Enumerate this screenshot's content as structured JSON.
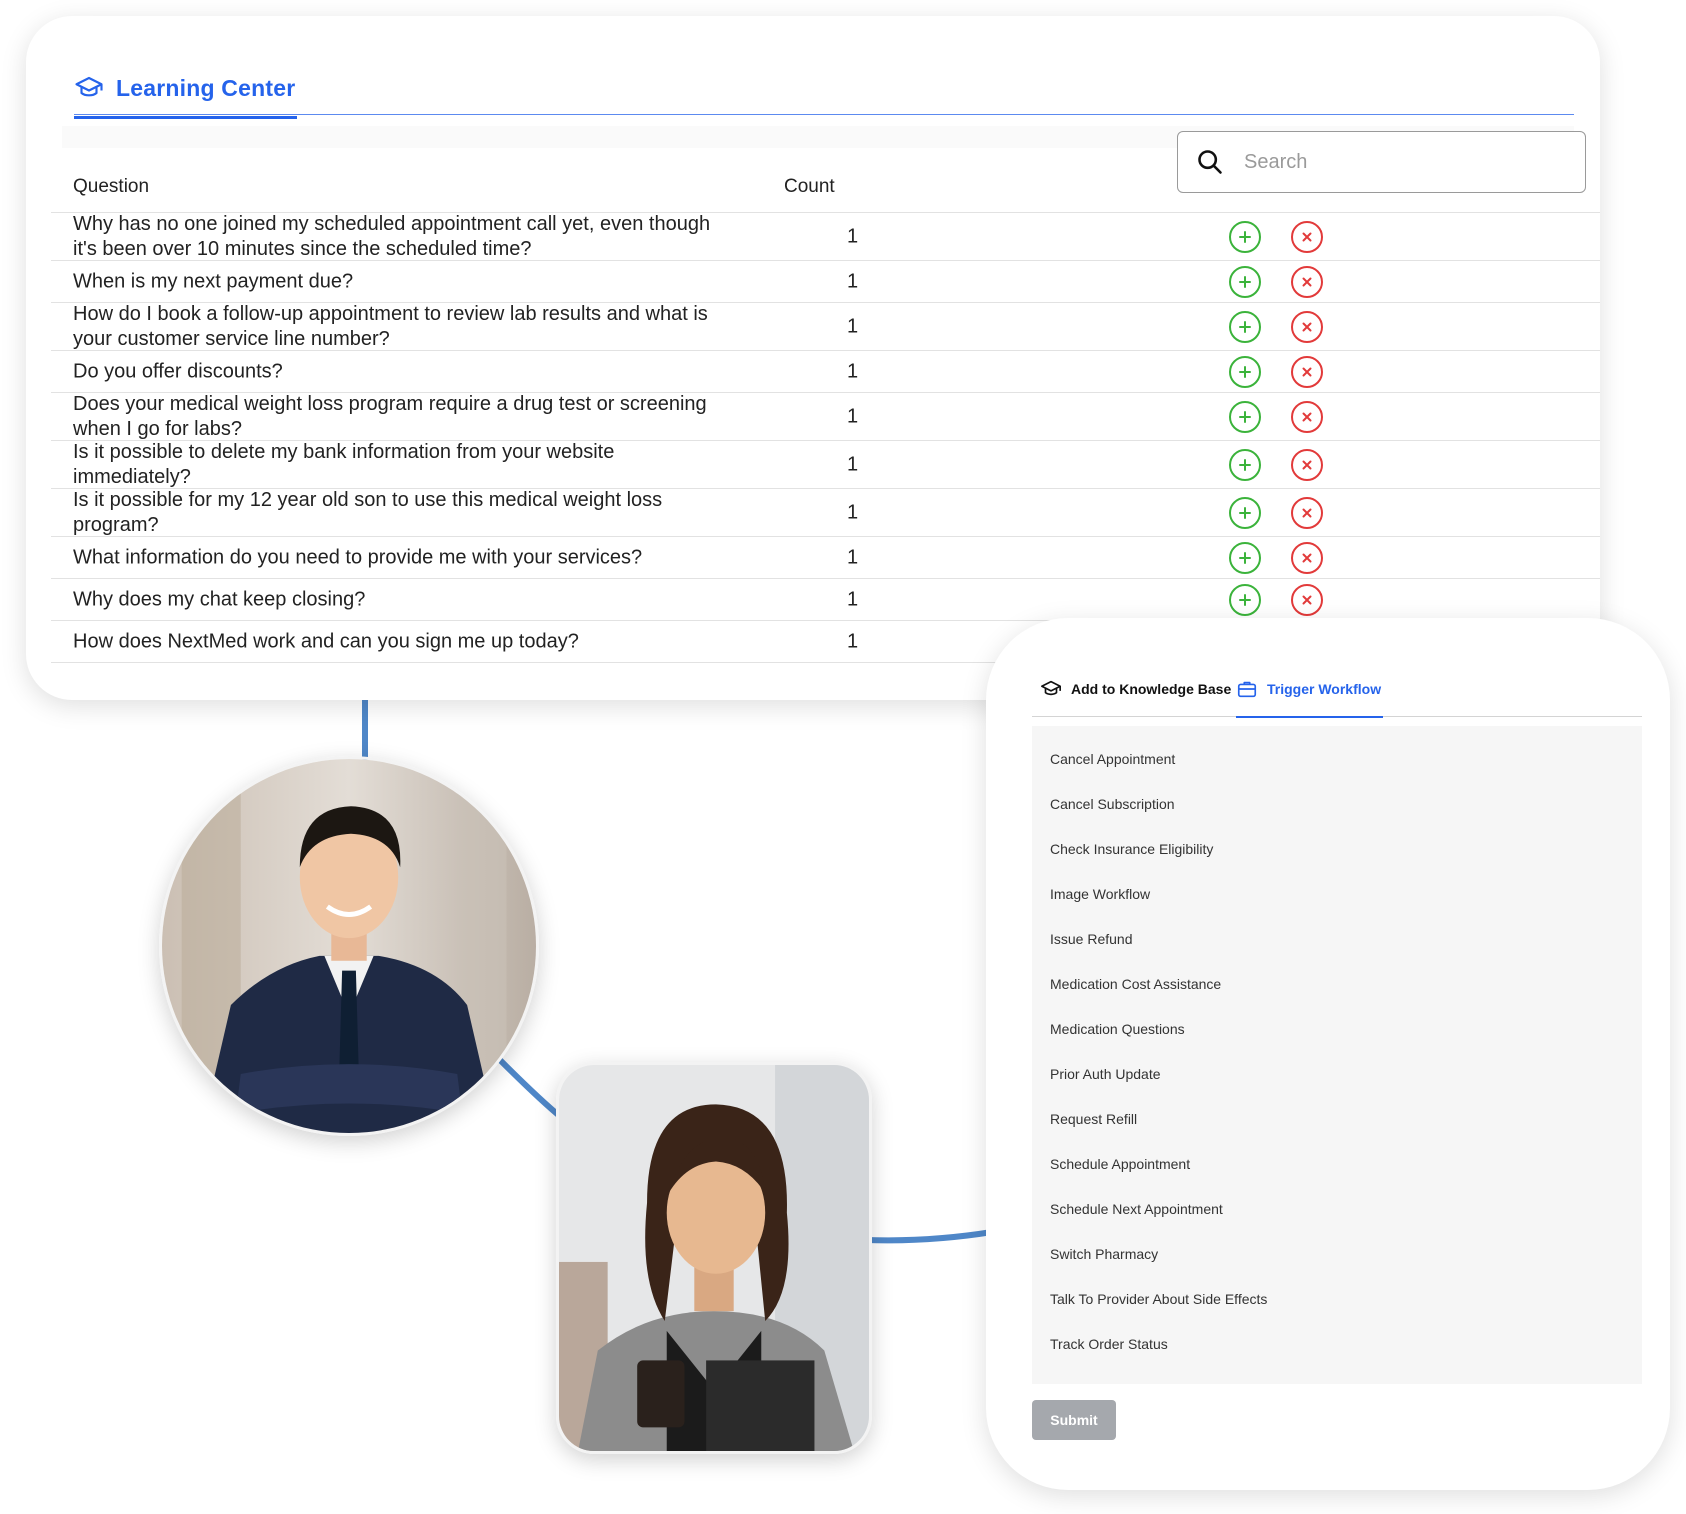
{
  "learning_center": {
    "title": "Learning Center",
    "columns": {
      "question": "Question",
      "count": "Count"
    },
    "search": {
      "placeholder": "Search",
      "value": ""
    },
    "rows": [
      {
        "question": "Why has no one joined my scheduled appointment call yet, even though it's been over 10 minutes since the scheduled time?",
        "count": "1"
      },
      {
        "question": "When is my next payment due?",
        "count": "1"
      },
      {
        "question": "How do I book a follow-up appointment to review lab results and what is your customer service line number?",
        "count": "1"
      },
      {
        "question": "Do you offer discounts?",
        "count": "1"
      },
      {
        "question": "Does your medical weight loss program require a drug test or screening when I go for labs?",
        "count": "1"
      },
      {
        "question": "Is it possible to delete my bank information from your website immediately?",
        "count": "1"
      },
      {
        "question": "Is it possible for my 12 year old son to use this medical weight loss program?",
        "count": "1"
      },
      {
        "question": "What information do you need to provide me with your services?",
        "count": "1"
      },
      {
        "question": "Why does my chat keep closing?",
        "count": "1"
      },
      {
        "question": "How does NextMed work and can you sign me up today?",
        "count": "1"
      }
    ],
    "actions": {
      "add_icon": "plus-circle-icon",
      "reject_icon": "x-circle-icon"
    }
  },
  "workflow_panel": {
    "tabs": [
      {
        "label": "Add to Knowledge Base",
        "icon": "graduation-cap-icon",
        "active": false
      },
      {
        "label": "Trigger Workflow",
        "icon": "briefcase-icon",
        "active": true
      }
    ],
    "workflows": [
      "Cancel Appointment",
      "Cancel Subscription",
      "Check Insurance Eligibility",
      "Image Workflow",
      "Issue Refund",
      "Medication Cost Assistance",
      "Medication Questions",
      "Prior Auth Update",
      "Request Refill",
      "Schedule Appointment",
      "Schedule Next Appointment",
      "Switch Pharmacy",
      "Talk To Provider About Side Effects",
      "Track Order Status"
    ],
    "submit_label": "Submit"
  },
  "colors": {
    "accent": "#2563eb",
    "add": "#3bb33b",
    "reject": "#e23a3a",
    "connector": "#4f87c8",
    "submit_disabled": "#a5a8ad"
  }
}
